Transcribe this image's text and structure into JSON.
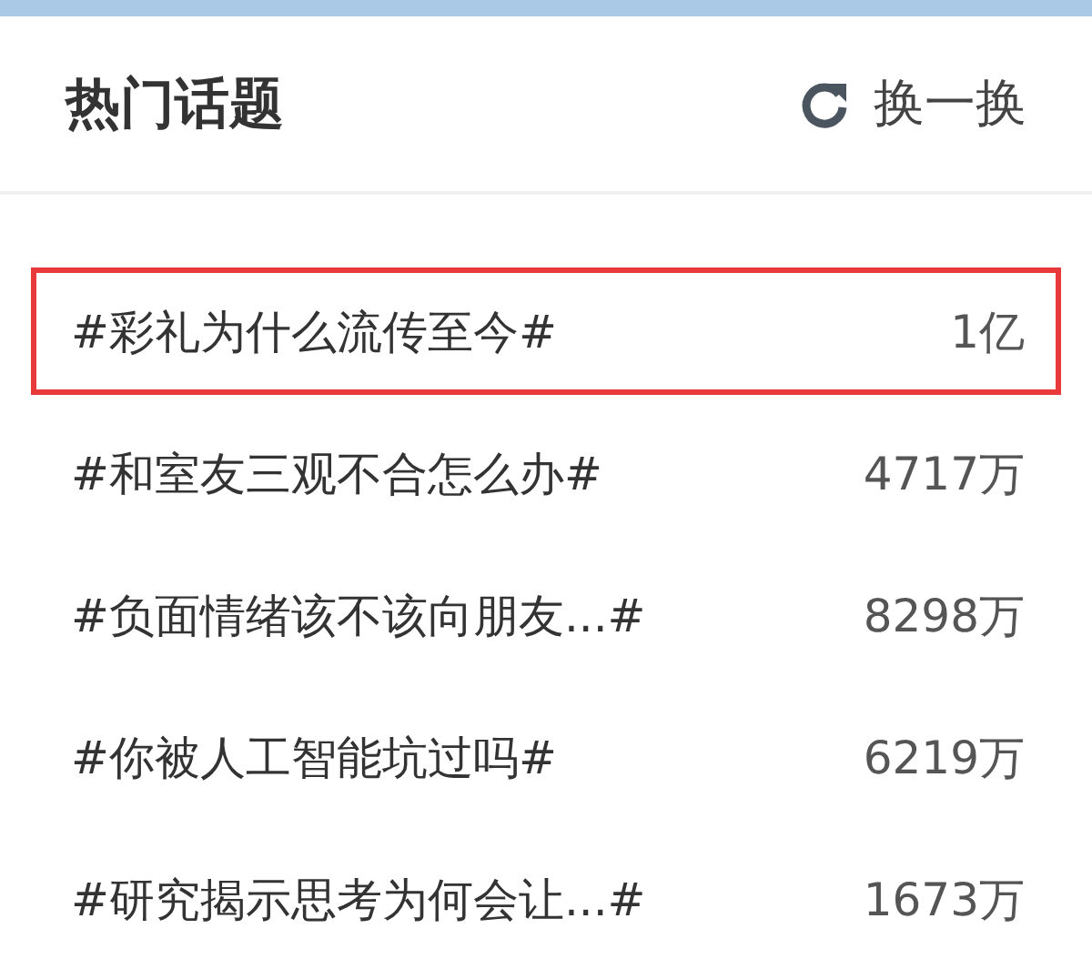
{
  "header": {
    "title": "热门话题",
    "refresh_label": "换一换"
  },
  "topics": [
    {
      "title": "#彩礼为什么流传至今#",
      "count": "1亿",
      "highlighted": true
    },
    {
      "title": "#和室友三观不合怎么办#",
      "count": "4717万",
      "highlighted": false
    },
    {
      "title": "#负面情绪该不该向朋友...#",
      "count": "8298万",
      "highlighted": false
    },
    {
      "title": "#你被人工智能坑过吗#",
      "count": "6219万",
      "highlighted": false
    },
    {
      "title": "#研究揭示思考为何会让...#",
      "count": "1673万",
      "highlighted": false
    }
  ]
}
